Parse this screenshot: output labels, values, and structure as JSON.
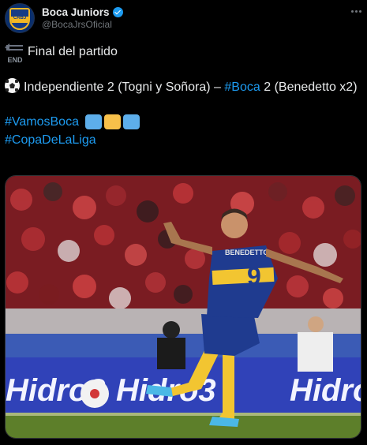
{
  "author": {
    "display_name": "Boca Juniors",
    "handle": "@BocaJrsOficial",
    "verified": true,
    "avatar_text": "CABJ",
    "avatar_colors": {
      "blue": "#163d86",
      "gold": "#f2b824"
    }
  },
  "icons": {
    "end": "end-arrow-icon",
    "ball": "soccer-ball-icon",
    "more": "more-options-icon",
    "verified": "verified-badge-icon"
  },
  "end_icon_text": "END",
  "tweet": {
    "line1": "Final del partido",
    "line2_prefix": "Independiente 2 (Togni y Soñora) – ",
    "line2_hashtag": "#Boca",
    "line2_suffix": " 2 (Benedetto x2)",
    "hashtag_vamos": "#VamosBoca",
    "hashtag_copa": "#CopaDeLaLiga"
  },
  "media": {
    "jersey_name": "BENEDETTO",
    "jersey_number": "9",
    "ad_text": "Hidro3"
  },
  "colors": {
    "background": "#000000",
    "text": "#e7e9ea",
    "muted": "#71767b",
    "link": "#1d9bf0",
    "heart_blue": "#5daeea",
    "heart_yellow": "#f7c04a"
  }
}
